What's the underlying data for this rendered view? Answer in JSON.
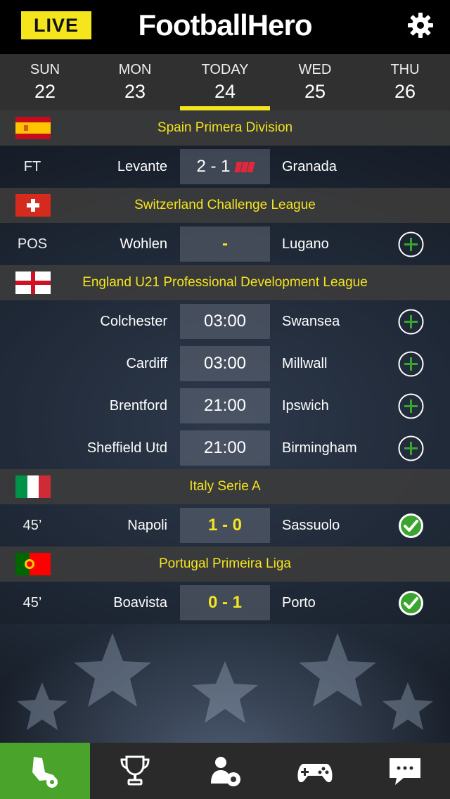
{
  "header": {
    "live_label": "LIVE",
    "app_title": "FootballHero",
    "settings_icon": "gear-icon"
  },
  "dates": [
    {
      "day": "SUN",
      "num": "22",
      "active": false
    },
    {
      "day": "MON",
      "num": "23",
      "active": false
    },
    {
      "day": "TODAY",
      "num": "24",
      "active": true
    },
    {
      "day": "WED",
      "num": "25",
      "active": false
    },
    {
      "day": "THU",
      "num": "26",
      "active": false
    }
  ],
  "leagues": [
    {
      "name": "Spain Primera Division",
      "flag": "spain-flag-icon",
      "matches": [
        {
          "status": "FT",
          "home": "Levante",
          "score": "2 - 1",
          "away": "Granada",
          "red_cards": 3
        }
      ]
    },
    {
      "name": "Switzerland Challenge League",
      "flag": "switzerland-flag-icon",
      "matches": [
        {
          "status": "POS",
          "home": "Wohlen",
          "score": "-",
          "away": "Lugano",
          "action": "add"
        }
      ]
    },
    {
      "name": "England U21 Professional Development League",
      "flag": "england-flag-icon",
      "matches": [
        {
          "status": "",
          "home": "Colchester",
          "score": "03:00",
          "away": "Swansea",
          "action": "add"
        },
        {
          "status": "",
          "home": "Cardiff",
          "score": "03:00",
          "away": "Millwall",
          "action": "add"
        },
        {
          "status": "",
          "home": "Brentford",
          "score": "21:00",
          "away": "Ipswich",
          "action": "add"
        },
        {
          "status": "",
          "home": "Sheffield Utd",
          "score": "21:00",
          "away": "Birmingham",
          "action": "add"
        }
      ]
    },
    {
      "name": "Italy Serie A",
      "flag": "italy-flag-icon",
      "matches": [
        {
          "status": "45’",
          "home": "Napoli",
          "score": "1 - 0",
          "away": "Sassuolo",
          "action": "done"
        }
      ]
    },
    {
      "name": "Portugal Primeira Liga",
      "flag": "portugal-flag-icon",
      "matches": [
        {
          "status": "45’",
          "home": "Boavista",
          "score": "0 - 1",
          "away": "Porto",
          "action": "done"
        }
      ]
    }
  ],
  "bottom_nav": [
    {
      "icon": "football-boot-icon",
      "active": true
    },
    {
      "icon": "trophy-icon",
      "active": false
    },
    {
      "icon": "user-football-icon",
      "active": false
    },
    {
      "icon": "gamepad-icon",
      "active": false
    },
    {
      "icon": "chat-bubble-icon",
      "active": false
    }
  ],
  "colors": {
    "accent_yellow": "#f4e51d",
    "active_green": "#4aa32a",
    "action_green": "#3aa52e",
    "red_card": "#e0273b"
  }
}
